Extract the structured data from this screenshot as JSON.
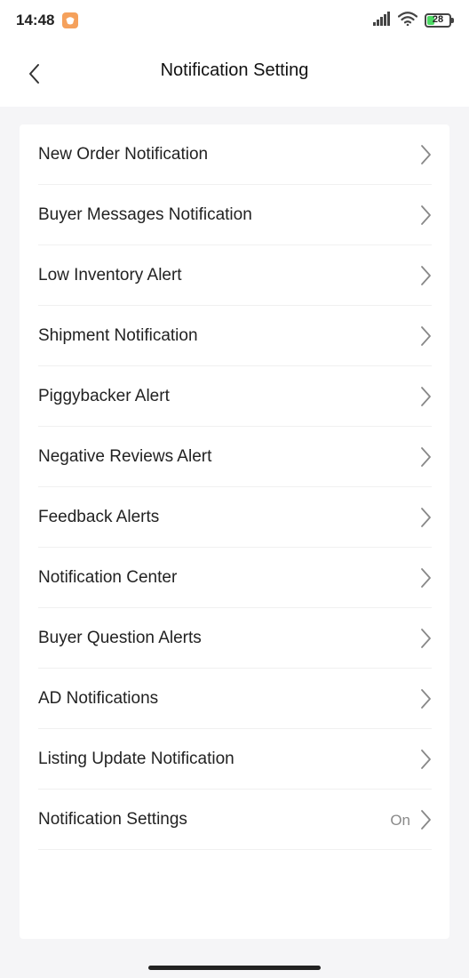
{
  "status_bar": {
    "time": "14:48",
    "battery_level": "28"
  },
  "header": {
    "title": "Notification Setting"
  },
  "settings": {
    "items": [
      {
        "label": "New Order Notification",
        "value": ""
      },
      {
        "label": "Buyer Messages Notification",
        "value": ""
      },
      {
        "label": "Low Inventory Alert",
        "value": ""
      },
      {
        "label": "Shipment Notification",
        "value": ""
      },
      {
        "label": "Piggybacker Alert",
        "value": ""
      },
      {
        "label": "Negative Reviews Alert",
        "value": ""
      },
      {
        "label": "Feedback Alerts",
        "value": ""
      },
      {
        "label": "Notification Center",
        "value": ""
      },
      {
        "label": "Buyer Question Alerts",
        "value": ""
      },
      {
        "label": "AD Notifications",
        "value": ""
      },
      {
        "label": "Listing Update Notification",
        "value": ""
      },
      {
        "label": "Notification Settings",
        "value": "On"
      }
    ]
  },
  "colors": {
    "background": "#f5f5f7",
    "card": "#ffffff",
    "app_badge": "#f5a15c",
    "battery_fill": "#4cd964"
  },
  "icons": {
    "back": "chevron-left-icon",
    "row": "chevron-right-icon",
    "signal": "signal-icon",
    "wifi": "wifi-icon",
    "battery": "battery-icon",
    "app_badge": "app-badge-icon"
  }
}
